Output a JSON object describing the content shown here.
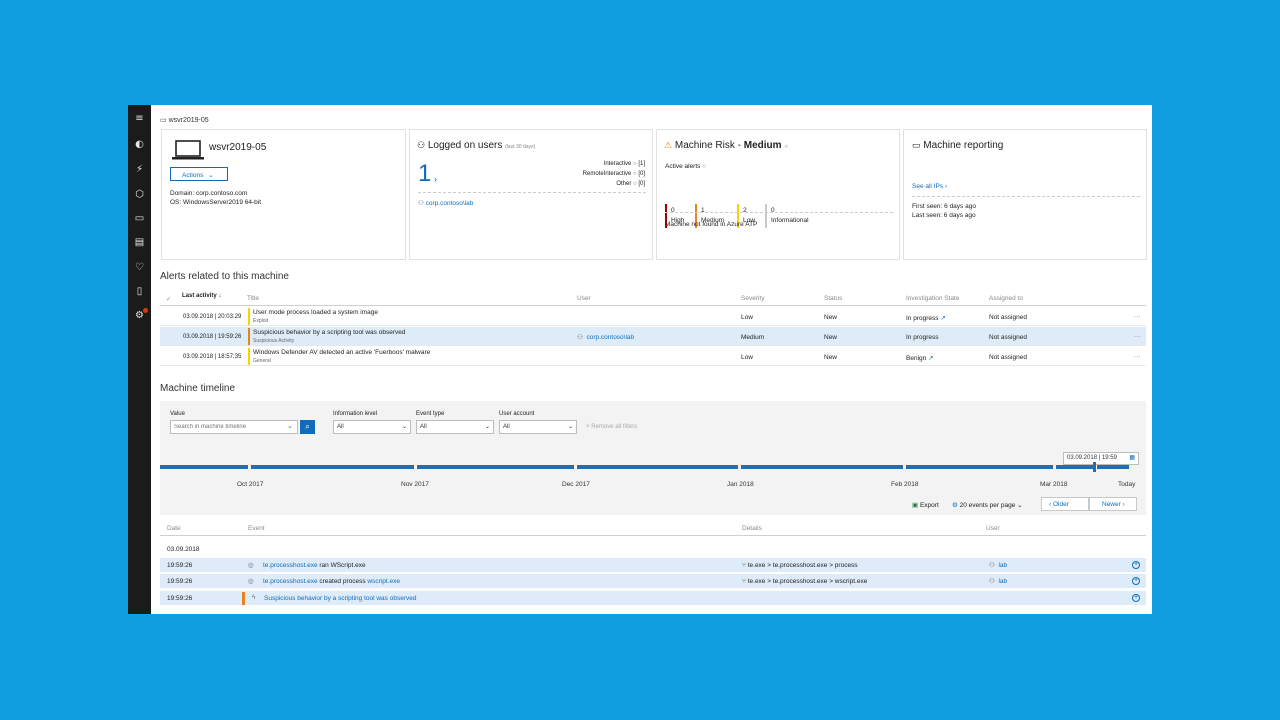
{
  "breadcrumb": "wsvr2019-05",
  "machine": {
    "name": "wsvr2019-05",
    "actions_label": "Actions",
    "domain": "Domain: corp.contoso.com",
    "os": "OS: WindowsServer2019 64-bit"
  },
  "logged_on": {
    "title": "Logged on users",
    "period": "(last 30 days)",
    "count": "1",
    "breakdown": [
      {
        "label": "Interactive",
        "value": "[1]"
      },
      {
        "label": "RemoteInteractive",
        "value": "[0]"
      },
      {
        "label": "Other",
        "value": "[0]"
      }
    ],
    "user": "corp.contoso\\lab"
  },
  "risk": {
    "title_prefix": "Machine Risk - ",
    "level": "Medium",
    "active_alerts_label": "Active alerts",
    "counts": [
      {
        "value": "0",
        "label": "High",
        "color": "#a80000"
      },
      {
        "value": "1",
        "label": "Medium",
        "color": "#e8821c"
      },
      {
        "value": "2",
        "label": "Low",
        "color": "#f2d600"
      },
      {
        "value": "0",
        "label": "Informational",
        "color": "#c8c8c8"
      }
    ],
    "atp_note": "Machine not found in Azure ATP"
  },
  "reporting": {
    "title": "Machine reporting",
    "see_all": "See all IPs",
    "first_seen": "First seen: 6 days ago",
    "last_seen": "Last seen: 6 days ago"
  },
  "alerts": {
    "title": "Alerts related to this machine",
    "columns": [
      "Last activity",
      "Title",
      "User",
      "Severity",
      "Status",
      "Investigation State",
      "Assigned to"
    ],
    "rows": [
      {
        "time": "03.09.2018 | 20:03:29",
        "title": "User mode process loaded a system image",
        "category": "Exploit",
        "user": "",
        "severity": "Low",
        "status": "New",
        "investigation": "In progress",
        "assigned": "Not assigned",
        "bar": "#f2d600"
      },
      {
        "time": "03.09.2018 | 19:59:26",
        "title": "Suspicious behavior by a scripting tool was observed",
        "category": "Suspicious Activity",
        "user": "corp.contoso\\lab",
        "severity": "Medium",
        "status": "New",
        "investigation": "In progress",
        "assigned": "Not assigned",
        "bar": "#e8821c"
      },
      {
        "time": "03.09.2018 | 18:57:35",
        "title": "Windows Defender AV detected an active 'Fuerboos' malware",
        "category": "General",
        "user": "",
        "severity": "Low",
        "status": "New",
        "investigation": "Benign",
        "assigned": "Not assigned",
        "bar": "#f2d600"
      }
    ],
    "more": "···"
  },
  "timeline": {
    "title": "Machine timeline",
    "value_label": "Value",
    "search_placeholder": "Search in machine timeline",
    "info_label": "Information level",
    "info_value": "All",
    "event_label": "Event type",
    "event_value": "All",
    "user_label": "User account",
    "user_value": "All",
    "remove_filters": "Remove all filters",
    "date_box": "03.09.2018 | 19:59",
    "months": [
      "Oct 2017",
      "Nov 2017",
      "Dec 2017",
      "Jan 2018",
      "Feb 2018",
      "Mar 2018",
      "Today"
    ],
    "export": "Export",
    "per_page": "20 events per page",
    "older": "Older",
    "newer": "Newer",
    "columns": [
      "Date",
      "Event",
      "Details",
      "User"
    ],
    "date_group": "03.09.2018",
    "events": [
      {
        "time": "19:59:26",
        "link": "te.processhost.exe",
        "text": " ran WScript.exe",
        "link2": "",
        "details": "te.exe > te.processhost.exe > process",
        "user": "lab"
      },
      {
        "time": "19:59:26",
        "link": "te.processhost.exe",
        "text": " created process ",
        "link2": "wscript.exe",
        "details": "te.exe > te.processhost.exe > wscript.exe",
        "user": "lab"
      },
      {
        "time": "19:59:26",
        "link": "Suspicious behavior by a scripting tool was observed",
        "text": "",
        "link2": "",
        "details": "",
        "user": ""
      }
    ]
  }
}
